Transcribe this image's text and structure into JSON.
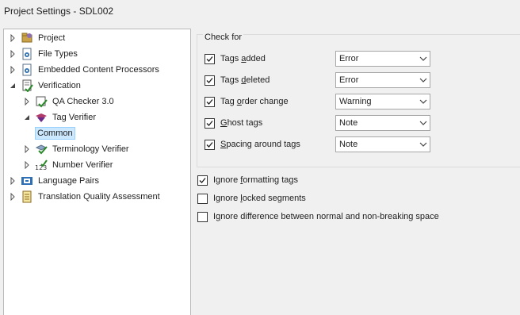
{
  "window": {
    "title": "Project Settings - SDL002"
  },
  "tree": {
    "items": [
      {
        "label": "Project",
        "icon": "project-icon",
        "expander": "collapsed"
      },
      {
        "label": "File Types",
        "icon": "file-types-icon",
        "expander": "collapsed"
      },
      {
        "label": "Embedded Content Processors",
        "icon": "embedded-content-icon",
        "expander": "collapsed"
      },
      {
        "label": "Verification",
        "icon": "verification-icon",
        "expander": "expanded"
      },
      {
        "label": "QA Checker 3.0",
        "icon": "qa-checker-icon",
        "expander": "collapsed"
      },
      {
        "label": "Tag Verifier",
        "icon": "tag-verifier-icon",
        "expander": "expanded"
      },
      {
        "label": "Common",
        "icon": "",
        "expander": "none",
        "selected": true
      },
      {
        "label": "Terminology Verifier",
        "icon": "terminology-verifier-icon",
        "expander": "collapsed"
      },
      {
        "label": "Number Verifier",
        "icon": "number-verifier-icon",
        "expander": "collapsed"
      },
      {
        "label": "Language Pairs",
        "icon": "language-pairs-icon",
        "expander": "collapsed"
      },
      {
        "label": "Translation Quality Assessment",
        "icon": "translation-quality-icon",
        "expander": "collapsed"
      }
    ]
  },
  "check_for": {
    "title": "Check for",
    "rows": [
      {
        "pre": "Tags ",
        "key": "a",
        "post": "dded",
        "checked": true,
        "severity": "Error"
      },
      {
        "pre": "Tags ",
        "key": "d",
        "post": "eleted",
        "checked": true,
        "severity": "Error"
      },
      {
        "pre": "Tag ",
        "key": "o",
        "post": "rder change",
        "checked": true,
        "severity": "Warning"
      },
      {
        "pre": "",
        "key": "G",
        "post": "host tags",
        "checked": true,
        "severity": "Note"
      },
      {
        "pre": "",
        "key": "S",
        "post": "pacing around tags",
        "checked": true,
        "severity": "Note"
      }
    ]
  },
  "options": [
    {
      "pre": "Ignore ",
      "key": "f",
      "post": "ormatting tags",
      "checked": true
    },
    {
      "pre": "Ignore ",
      "key": "l",
      "post": "ocked segments",
      "checked": false
    },
    {
      "pre": "I",
      "key": "g",
      "post": "nore difference between normal and non-breaking space",
      "checked": false
    }
  ],
  "colors": {
    "selection_bg": "#cce8ff",
    "selection_border": "#99d1ff",
    "window_bg": "#f0f0f0"
  }
}
